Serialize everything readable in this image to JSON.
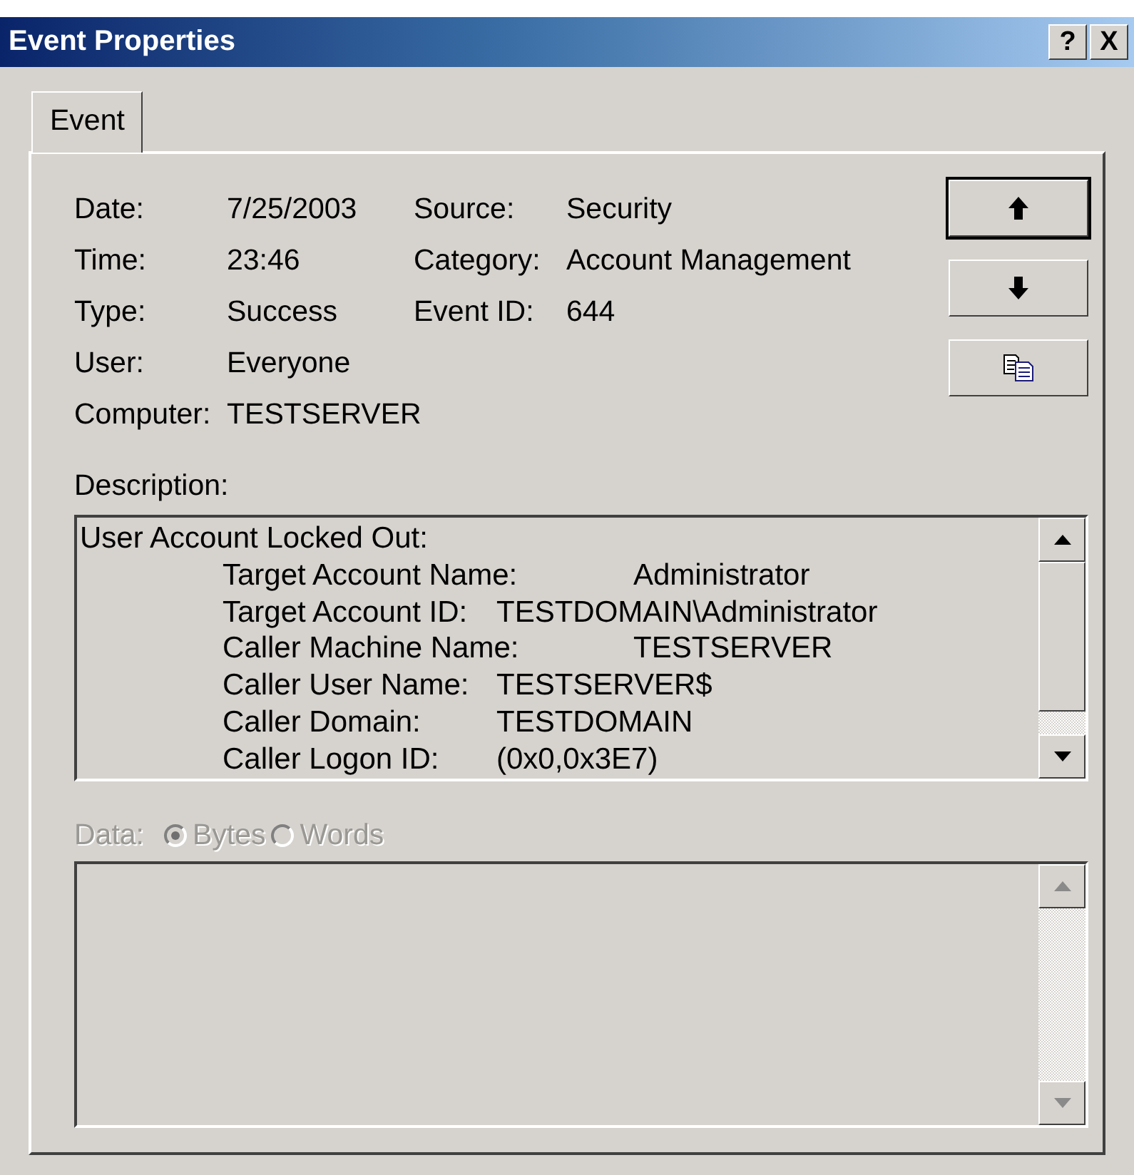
{
  "window": {
    "title": "Event Properties",
    "buttons": [
      "?",
      "X"
    ]
  },
  "tabs": [
    {
      "label": "Event",
      "selected": true
    }
  ],
  "fields": [
    {
      "cells": [
        {
          "label": "Date:",
          "value": "7/25/2003"
        },
        {
          "label": "Source:",
          "value": "Security"
        }
      ]
    },
    {
      "cells": [
        {
          "label": "Time:",
          "value": "23:46"
        },
        {
          "label": "Category:",
          "value": "Account Management"
        }
      ]
    },
    {
      "cells": [
        {
          "label": "Type:",
          "value": "Success"
        },
        {
          "label": "Event ID:",
          "value": "644"
        }
      ]
    },
    {
      "cells": [
        {
          "label": "User:",
          "value": "Everyone"
        }
      ]
    },
    {
      "cells": [
        {
          "label": "Computer:",
          "value": "TESTSERVER"
        }
      ]
    }
  ],
  "nav_buttons": [
    {
      "kind": "up"
    },
    {
      "kind": "down"
    },
    {
      "kind": "copy"
    }
  ],
  "description": {
    "label": "Description:",
    "heading": "User Account Locked Out:",
    "entries": [
      {
        "label": "Target Account Name:",
        "value": "Administrator"
      },
      {
        "label": "Target Account ID:",
        "value": "TESTDOMAIN\\Administrator"
      },
      {
        "label": "Caller Machine Name:",
        "value": "TESTSERVER"
      },
      {
        "label": "Caller User Name:",
        "value": "TESTSERVER$"
      },
      {
        "label": "Caller Domain:",
        "value": "TESTDOMAIN"
      },
      {
        "label": "Caller Logon ID:",
        "value": "(0x0,0x3E7)"
      }
    ]
  },
  "data": {
    "label": "Data:",
    "disabled": true,
    "options": [
      {
        "label": "Bytes",
        "selected": true
      },
      {
        "label": "Words",
        "selected": false
      }
    ]
  }
}
